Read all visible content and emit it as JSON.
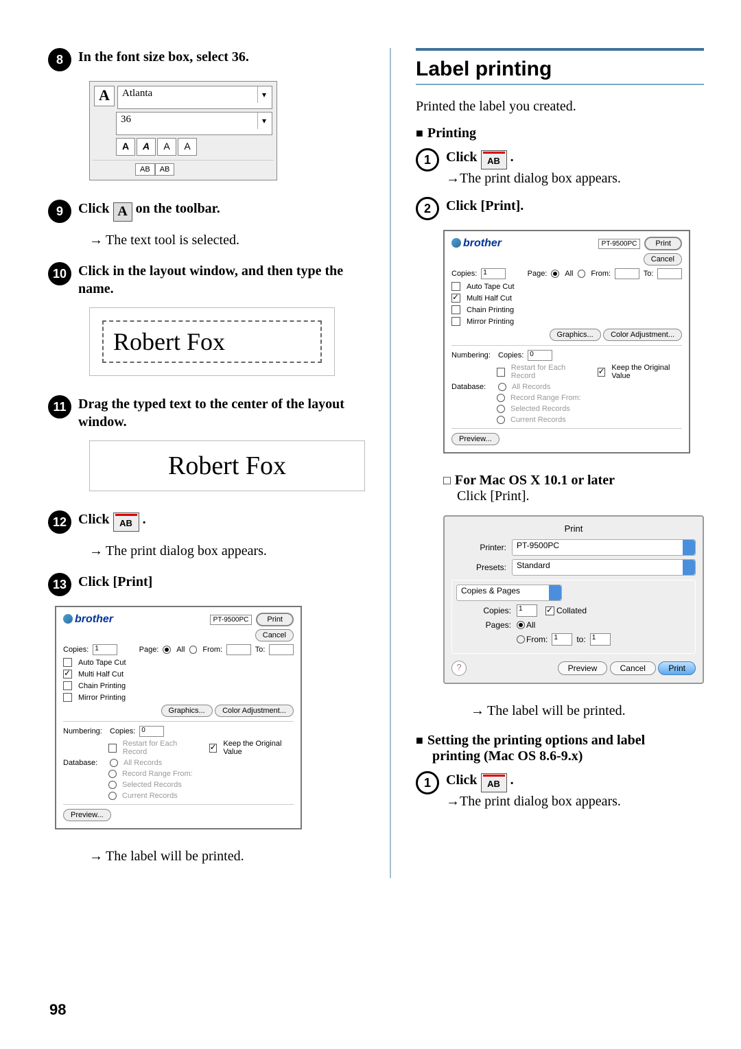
{
  "pageNumber": "98",
  "left": {
    "step8": {
      "text": "In the font size box, select 36."
    },
    "fontbox": {
      "font": "Atlanta",
      "size": "36"
    },
    "step9": {
      "pre": "Click ",
      "post": " on the toolbar.",
      "result": "The text tool is selected."
    },
    "step10": {
      "text": "Click in the layout window, and then type the name.",
      "sample": "Robert Fox"
    },
    "step11": {
      "text": "Drag the typed text to the center of the layout window.",
      "sample": "Robert Fox"
    },
    "step12": {
      "pre": "Click ",
      "post": " .",
      "result": "The print dialog box appears."
    },
    "step13": {
      "text": "Click [Print]"
    },
    "afterDlg": "The label will be printed."
  },
  "right": {
    "title": "Label printing",
    "intro": "Printed the label you created.",
    "printingHeader": "Printing",
    "step1": {
      "pre": "Click ",
      "post": " .",
      "result": "The print dialog box appears."
    },
    "step2": {
      "text": "Click [Print]."
    },
    "macHeader": "For Mac OS X 10.1 or later",
    "macLine": "Click [Print].",
    "afterMac": "The label will be printed.",
    "settingHeader1": "Setting the printing options and label",
    "settingHeader2": "printing (Mac OS 8.6-9.x)",
    "step1b": {
      "pre": "Click ",
      "post": " .",
      "result": "The print dialog box appears."
    }
  },
  "brotherDialog": {
    "logo": "brother",
    "printer": "PT-9500PC",
    "printBtn": "Print",
    "cancelBtn": "Cancel",
    "copiesLabel": "Copies:",
    "copiesVal": "1",
    "pageLabel": "Page:",
    "all": "All",
    "fromLabel": "From:",
    "toLabel": "To:",
    "opts": {
      "autoTape": "Auto Tape Cut",
      "multiHalf": "Multi Half Cut",
      "chain": "Chain Printing",
      "mirror": "Mirror Printing"
    },
    "graphicsBtn": "Graphics...",
    "colorBtn": "Color Adjustment...",
    "numbering": "Numbering:",
    "numCopies": "Copies:",
    "numCopiesVal": "0",
    "restart": "Restart for Each Record",
    "keep": "Keep the Original Value",
    "database": "Database:",
    "dbAll": "All Records",
    "dbRange": "Record Range From:",
    "dbSel": "Selected Records",
    "dbCur": "Current Records",
    "previewBtn": "Preview..."
  },
  "macDialog": {
    "title": "Print",
    "printerLabel": "Printer:",
    "printerVal": "PT-9500PC",
    "presetsLabel": "Presets:",
    "presetsVal": "Standard",
    "copiesPages": "Copies & Pages",
    "copiesLabel": "Copies:",
    "copiesVal": "1",
    "collated": "Collated",
    "pagesLabel": "Pages:",
    "all": "All",
    "from": "From:",
    "fromVal": "1",
    "to": "to:",
    "toVal": "1",
    "preview": "Preview",
    "cancel": "Cancel",
    "print": "Print"
  }
}
